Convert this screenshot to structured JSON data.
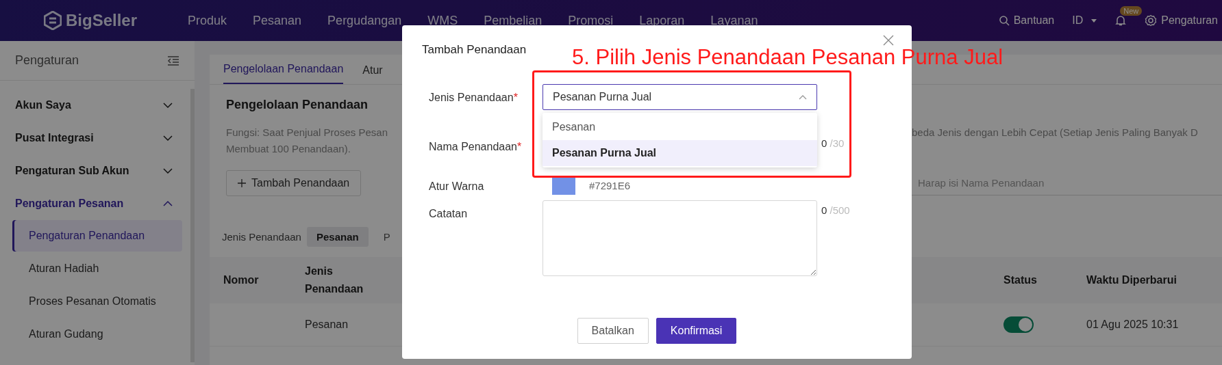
{
  "header": {
    "logo": "BigSeller",
    "nav": [
      "Produk",
      "Pesanan",
      "Pergudangan",
      "WMS",
      "Pembelian",
      "Promosi",
      "Laporan",
      "Layanan"
    ],
    "help": "Bantuan",
    "language": "ID",
    "badge": "New",
    "settings": "Pengaturan"
  },
  "sidebar": {
    "title": "Pengaturan",
    "items": [
      {
        "label": "Akun Saya",
        "expanded": false
      },
      {
        "label": "Pusat Integrasi",
        "expanded": false
      },
      {
        "label": "Pengaturan Sub Akun",
        "expanded": false
      },
      {
        "label": "Pengaturan Pesanan",
        "expanded": true,
        "children": [
          {
            "label": "Pengaturan Penandaan",
            "selected": true
          },
          {
            "label": "Aturan Hadiah",
            "selected": false
          },
          {
            "label": "Proses Pesanan Otomatis",
            "selected": false
          },
          {
            "label": "Aturan Gudang",
            "selected": false
          }
        ]
      }
    ]
  },
  "page": {
    "tabs": [
      {
        "label": "Pengelolaan Penandaan",
        "selected": true
      },
      {
        "label": "Atur",
        "selected": false
      }
    ],
    "heading": "Pengelolaan Penandaan",
    "description_left": [
      "Fungsi: Saat Penjual Proses Pesan",
      "Membuat 100 Penandaan)."
    ],
    "description_right": "beda Jenis dengan Lebih Cepat (Setiap Jenis Paling Banyak D",
    "add_button": "Tambah Penandaan",
    "search": {
      "placeholder": "Harap isi Nama Penandaan"
    },
    "filter": {
      "label": "Jenis Penandaan",
      "options": [
        {
          "label": "Pesanan",
          "selected": true
        },
        {
          "label": "P",
          "selected": false
        }
      ]
    },
    "table": {
      "columns_left": [
        "Nomor",
        "Jenis Penandaan"
      ],
      "columns_right": [
        "Status",
        "Waktu Diperbarui"
      ],
      "rows": [
        {
          "type": "Pesanan",
          "status_on": true,
          "updated": "01 Agu 2025 10:31"
        }
      ]
    }
  },
  "modal": {
    "title": "Tambah Penandaan",
    "fields": [
      {
        "kind": "select",
        "label": "Jenis Penandaan",
        "required_mark": "*",
        "value": "Pesanan Purna Jual",
        "open": true,
        "options": [
          {
            "label": "Pesanan",
            "selected": false
          },
          {
            "label": "Pesanan Purna Jual",
            "selected": true
          }
        ]
      },
      {
        "kind": "text",
        "label": "Nama Penandaan",
        "required_mark": "*",
        "count": "0",
        "limit": "/30"
      },
      {
        "kind": "color",
        "label": "Atur Warna",
        "value": "#7291E6"
      },
      {
        "kind": "textarea",
        "label": "Catatan",
        "count": "0",
        "limit": "/500"
      }
    ],
    "buttons": [
      {
        "label": "Batalkan",
        "kind": "secondary"
      },
      {
        "label": "Konfirmasi",
        "kind": "primary"
      }
    ]
  },
  "annotation": {
    "text": "5. Pilih Jenis Penandaan Pesanan Purna Jual"
  }
}
